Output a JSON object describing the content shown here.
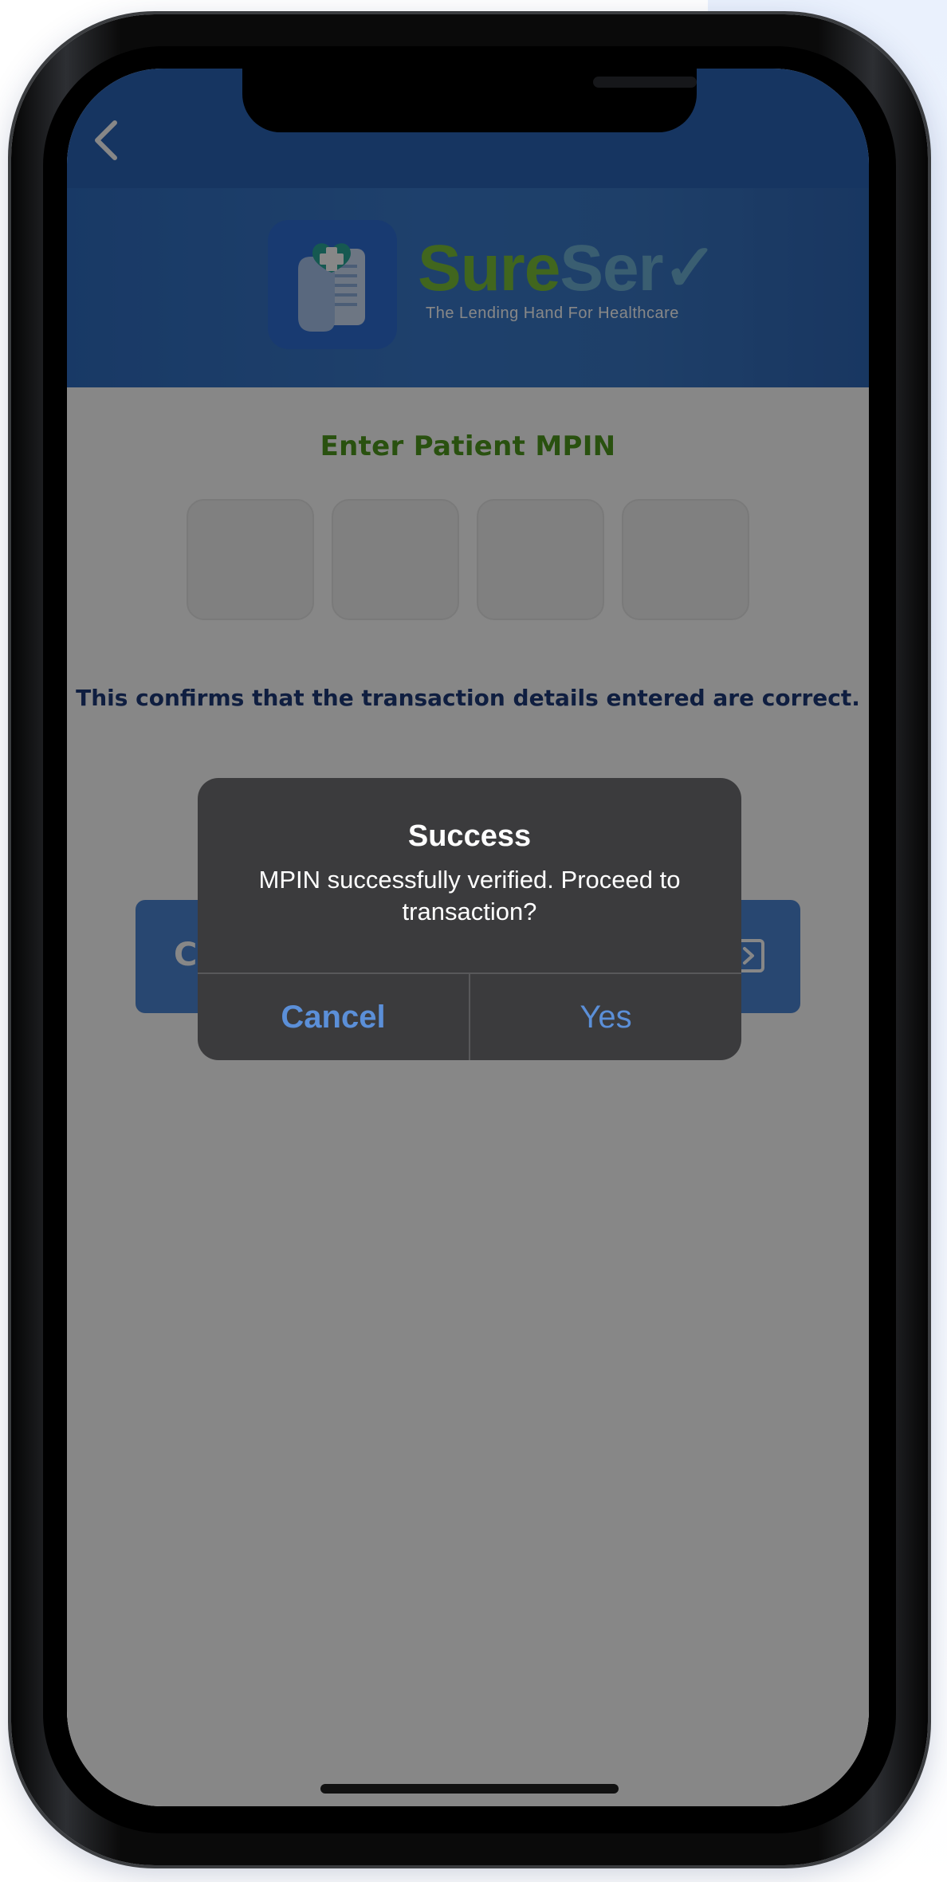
{
  "header": {
    "back_icon": "chevron-left-icon",
    "logo_icon": "heart-cross-document-icon",
    "brand_part1": "Sure",
    "brand_part2": "Ser",
    "brand_part3": "✓",
    "tagline": "The Lending Hand For Healthcare"
  },
  "form": {
    "title": "Enter Patient MPIN",
    "pin_length": 4,
    "confirm_text": "This confirms that the transaction details entered are correct.",
    "left_button_label": "C",
    "right_button_icon": "arrow-right-box-icon"
  },
  "alert": {
    "title": "Success",
    "message": "MPIN successfully verified. Proceed to transaction?",
    "cancel_label": "Cancel",
    "confirm_label": "Yes"
  },
  "colors": {
    "brand_blue": "#2f6dc0",
    "brand_green": "#7cc13a",
    "brand_teal": "#6fb1d6",
    "title_green": "#4f9a1d",
    "text_navy": "#1e3a7a",
    "alert_bg": "#3b3b3d",
    "alert_button": "#5b8fd8"
  }
}
